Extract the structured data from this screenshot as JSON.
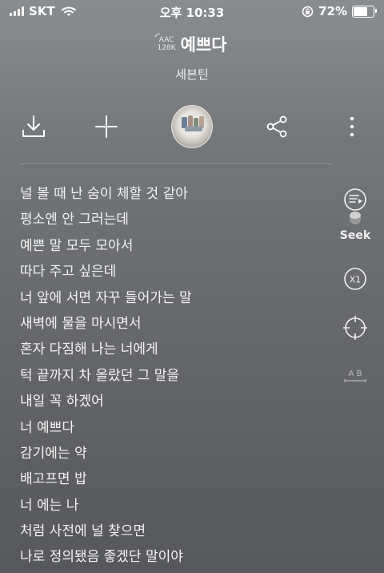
{
  "status_bar": {
    "carrier": "SKT",
    "time": "오후 10:33",
    "battery_percent": "72%",
    "battery_level": 0.72,
    "icons": [
      "signal-icon",
      "wifi-icon",
      "orientation-lock-icon",
      "battery-icon"
    ]
  },
  "player": {
    "codec_top": "AAC",
    "codec_bottom": "128K",
    "song_title": "예쁘다",
    "artist": "세븐틴"
  },
  "actions": {
    "icons": [
      "download-icon",
      "add-icon",
      "album-art",
      "share-icon",
      "more-icon"
    ]
  },
  "lyrics": [
    "널 볼 때 난 숨이 체할 것 같아",
    "평소엔 안 그러는데",
    "예쁜 말 모두 모아서",
    "따다 주고 싶은데",
    "너 앞에 서면 자꾸 들어가는 말",
    "새벽에 물을 마시면서",
    "혼자 다짐해 나는 너에게",
    "턱 끝까지 차 올랐던 그 말을",
    "내일 꼭 하겠어",
    "너 예쁘다",
    "감기에는 약",
    "배고프면 밥",
    "너 에는 나",
    "처럼 사전에 널 찾으면",
    "나로 정의됐음 좋겠단 말이야"
  ],
  "side_controls": {
    "seek_label": "Seek",
    "speed_label": "X1",
    "ab_label": "A B",
    "icons": [
      "seek-icon",
      "speed-icon",
      "crosshair-icon",
      "ab-repeat-icon"
    ]
  }
}
